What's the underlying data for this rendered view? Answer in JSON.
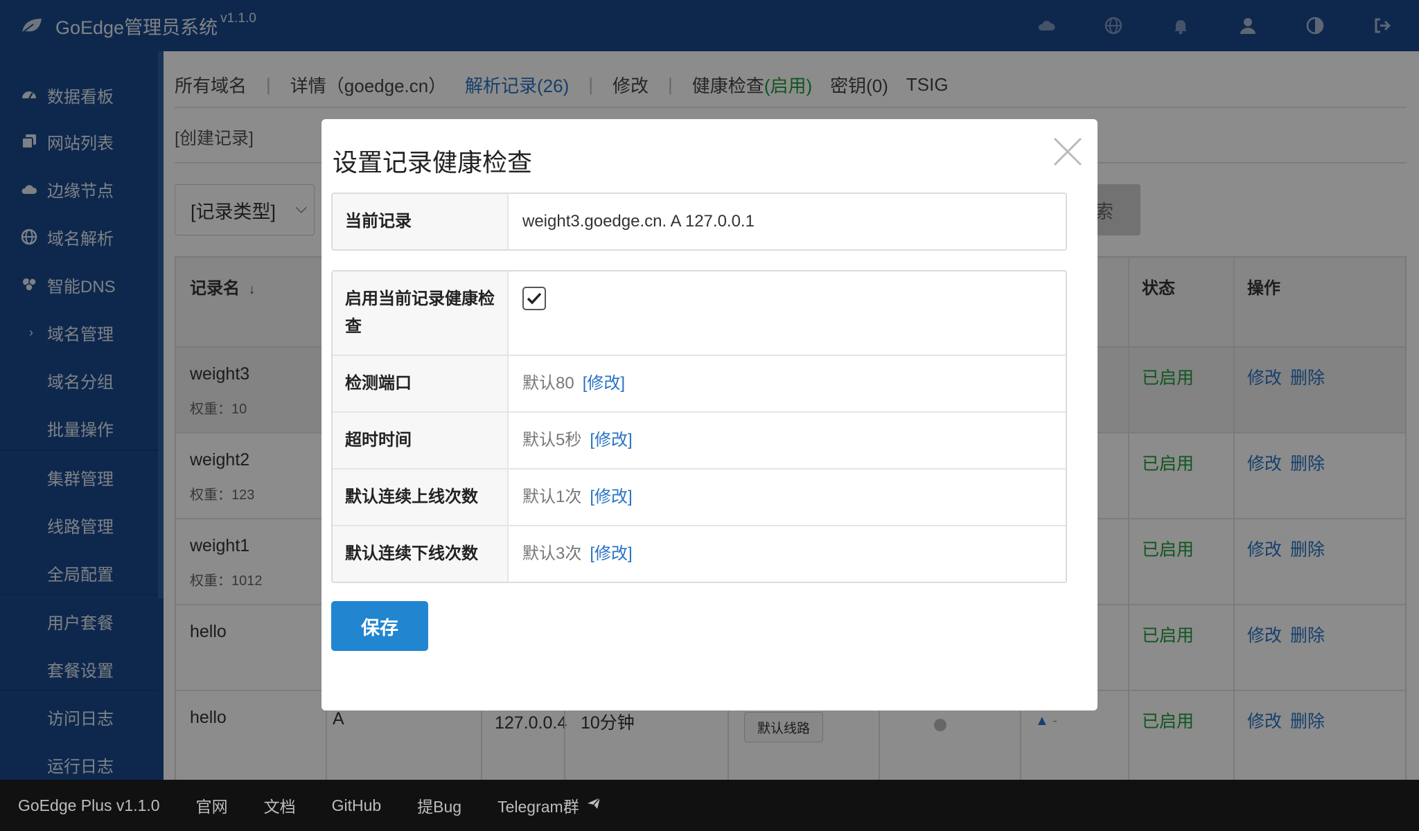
{
  "app": {
    "title": "GoEdge管理员系统",
    "version": "v1.1.0"
  },
  "topbar": {
    "icons": [
      "cloud-icon",
      "globe-icon",
      "bell-icon",
      "user-icon",
      "theme-toggle-icon",
      "logout-icon"
    ]
  },
  "sidebar": {
    "items": [
      {
        "label": "数据看板",
        "icon": "dashboard-icon"
      },
      {
        "label": "网站列表",
        "icon": "copy-icon"
      },
      {
        "label": "边缘节点",
        "icon": "cloud-icon"
      },
      {
        "label": "域名解析",
        "icon": "globe-icon"
      },
      {
        "label": "智能DNS",
        "icon": "dns-icon"
      },
      {
        "label": "域名管理",
        "icon": "chevron-right-icon"
      },
      {
        "label": "域名分组"
      },
      {
        "label": "批量操作"
      },
      {
        "label": "集群管理"
      },
      {
        "label": "线路管理"
      },
      {
        "label": "全局配置"
      },
      {
        "label": "用户套餐"
      },
      {
        "label": "套餐设置"
      },
      {
        "label": "访问日志"
      },
      {
        "label": "运行日志"
      }
    ]
  },
  "tabs": {
    "all_domains": "所有域名",
    "details": "详情（goedge.cn）",
    "records": "解析记录(26)",
    "edit": "修改",
    "health_prefix": "健康检查",
    "health_status": "(启用)",
    "keys": "密钥(0)",
    "tsig": "TSIG"
  },
  "toolbar": {
    "create_record": "[创建记录]",
    "record_type": "[记录类型]",
    "search_suffix": "索"
  },
  "table": {
    "headers": {
      "name": "记录名",
      "status": "状态",
      "ops": "操作"
    },
    "rows": [
      {
        "name": "weight3",
        "weight": "权重：10",
        "status": "已启用",
        "edit": "修改",
        "delete": "删除"
      },
      {
        "name": "weight2",
        "weight": "权重：123",
        "status": "已启用",
        "edit": "修改",
        "delete": "删除"
      },
      {
        "name": "weight1",
        "weight": "权重：1012",
        "status": "已启用",
        "edit": "修改",
        "delete": "删除"
      },
      {
        "name": "hello",
        "weight": "",
        "status": "已启用",
        "edit": "修改",
        "delete": "删除"
      },
      {
        "name": "hello",
        "weight": "",
        "type": "A",
        "value": "127.0.0.4",
        "ttl": "10分钟",
        "route": "默认线路",
        "chart_dash": "-",
        "status": "已启用",
        "edit": "修改",
        "delete": "删除"
      }
    ]
  },
  "modal": {
    "title": "设置记录健康检查",
    "current_record_label": "当前记录",
    "current_record_value": "weight3.goedge.cn. A 127.0.0.1",
    "enable_label": "启用当前记录健康检查",
    "enabled": true,
    "port_label": "检测端口",
    "port_value": "默认80",
    "timeout_label": "超时时间",
    "timeout_value": "默认5秒",
    "up_label": "默认连续上线次数",
    "up_value": "默认1次",
    "down_label": "默认连续下线次数",
    "down_value": "默认3次",
    "edit_link": "[修改]",
    "save": "保存"
  },
  "footer": {
    "version": "GoEdge Plus v1.1.0",
    "links": [
      "官网",
      "文档",
      "GitHub",
      "提Bug",
      "Telegram群"
    ]
  }
}
